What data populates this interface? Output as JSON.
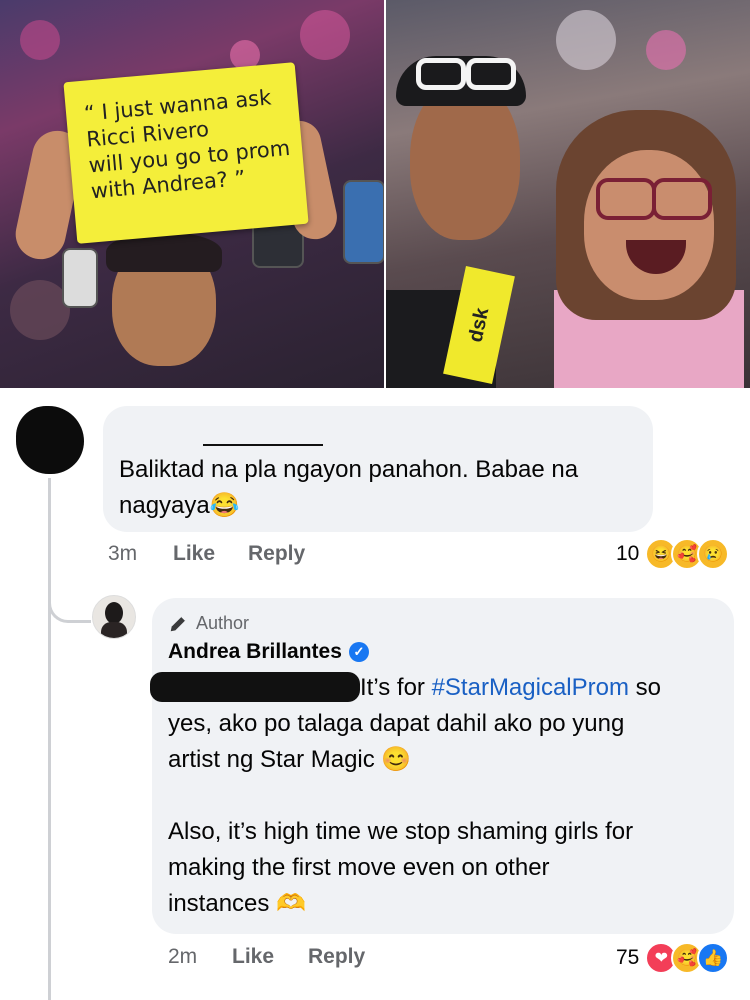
{
  "photo_left": {
    "sign_lines": [
      "“ I just wanna ask",
      "Ricci Rivero",
      "will you go to prom",
      "with Andrea? ”"
    ]
  },
  "photo_right": {
    "banner_text": "dsk"
  },
  "comment1": {
    "text_line1": "Baliktad na pla ngayon panahon. Babae na",
    "text_line2": "nagyaya",
    "emoji": "😂",
    "time": "3m",
    "like_label": "Like",
    "reply_label": "Reply",
    "reaction_count": "10",
    "reactions": [
      "😆",
      "🥰",
      "😢"
    ]
  },
  "reply1": {
    "author_tag": "Author",
    "author_name": "Andrea Brillantes",
    "line1_rest": "It’s for ",
    "hashtag": "#StarMagicalProm",
    "line1_end": " so",
    "line2": "yes, ako po talaga dapat dahil ako po yung",
    "line3": "artist ng Star Magic",
    "line3_emoji": "😊",
    "line5": "Also, it’s high time we stop shaming girls for",
    "line6": "making the first move even on other",
    "line7": "instances",
    "line7_emoji": "🫶",
    "time": "2m",
    "like_label": "Like",
    "reply_label": "Reply",
    "reaction_count": "75",
    "reactions": [
      "❤",
      "🥰",
      "👍"
    ]
  }
}
